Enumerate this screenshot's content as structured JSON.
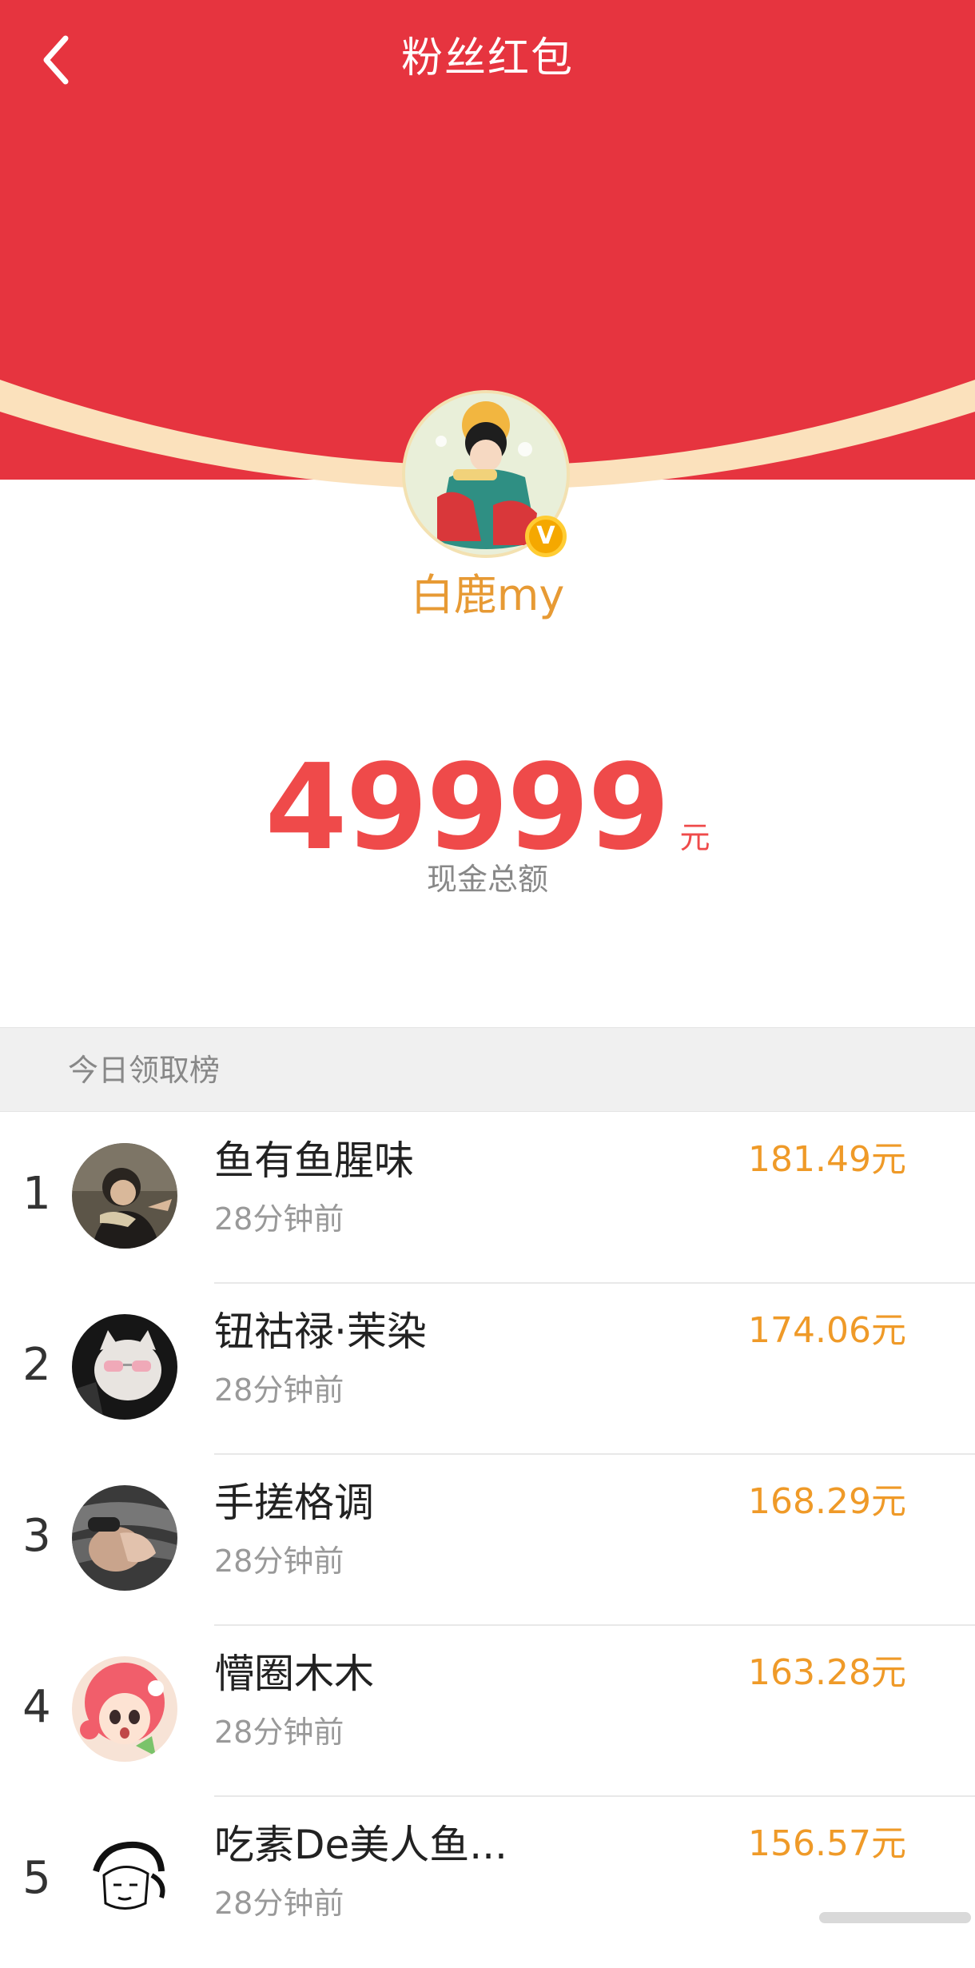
{
  "header": {
    "title": "粉丝红包",
    "accent_color": "#e6343f"
  },
  "icons": {
    "back": "chevron-left-icon",
    "verified": "verified-v-icon"
  },
  "profile": {
    "username": "白鹿my",
    "verified_mark": "V"
  },
  "total": {
    "amount": "49999",
    "unit": "元",
    "label": "现金总额"
  },
  "leaderboard": {
    "title": "今日领取榜",
    "rows": [
      {
        "rank": "1",
        "name": "鱼有鱼腥味",
        "time": "28分钟前",
        "amount": "181.49元"
      },
      {
        "rank": "2",
        "name": "钮祜禄·茉染",
        "time": "28分钟前",
        "amount": "174.06元"
      },
      {
        "rank": "3",
        "name": "手搓格调",
        "time": "28分钟前",
        "amount": "168.29元"
      },
      {
        "rank": "4",
        "name": "懵圈木木",
        "time": "28分钟前",
        "amount": "163.28元"
      },
      {
        "rank": "5",
        "name": "吃素De美人鱼...",
        "time": "28分钟前",
        "amount": "156.57元"
      }
    ]
  }
}
